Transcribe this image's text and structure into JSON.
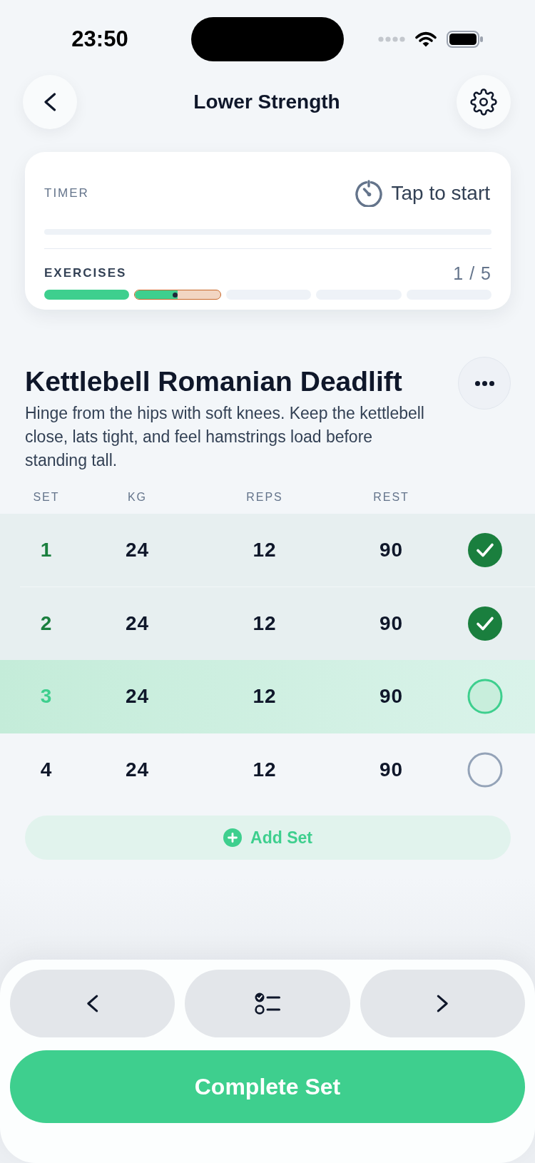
{
  "status_bar": {
    "time": "23:50"
  },
  "header": {
    "title": "Lower Strength"
  },
  "progress_card": {
    "timer": {
      "label": "TIMER",
      "action": "Tap to start"
    },
    "exercises": {
      "label": "EXERCISES",
      "count": "1 / 5",
      "segments": [
        {
          "kind": "done"
        },
        {
          "kind": "current",
          "level": 0.5
        },
        {
          "kind": "upcoming"
        },
        {
          "kind": "upcoming"
        },
        {
          "kind": "upcoming"
        }
      ]
    }
  },
  "exercise": {
    "title": "Kettlebell Romanian Deadlift",
    "description": "Hinge from the hips with soft knees. Keep the kettlebell close, lats tight, and feel hamstrings load before standing tall."
  },
  "sets_table": {
    "columns": [
      "SET",
      "KG",
      "REPS",
      "REST"
    ],
    "rows": [
      {
        "set": "1",
        "kg": "24",
        "reps": "12",
        "rest": "90",
        "checked": true,
        "current": false
      },
      {
        "set": "2",
        "kg": "24",
        "reps": "12",
        "rest": "90",
        "checked": true,
        "current": false
      },
      {
        "set": "3",
        "kg": "24",
        "reps": "12",
        "rest": "90",
        "checked": false,
        "current": true
      },
      {
        "set": "4",
        "kg": "24",
        "reps": "12",
        "rest": "90",
        "checked": false,
        "current": false
      }
    ]
  },
  "add_set_button": {
    "label": "Add Set"
  },
  "footer": {
    "complete_button": {
      "label": "Complete Set"
    }
  }
}
